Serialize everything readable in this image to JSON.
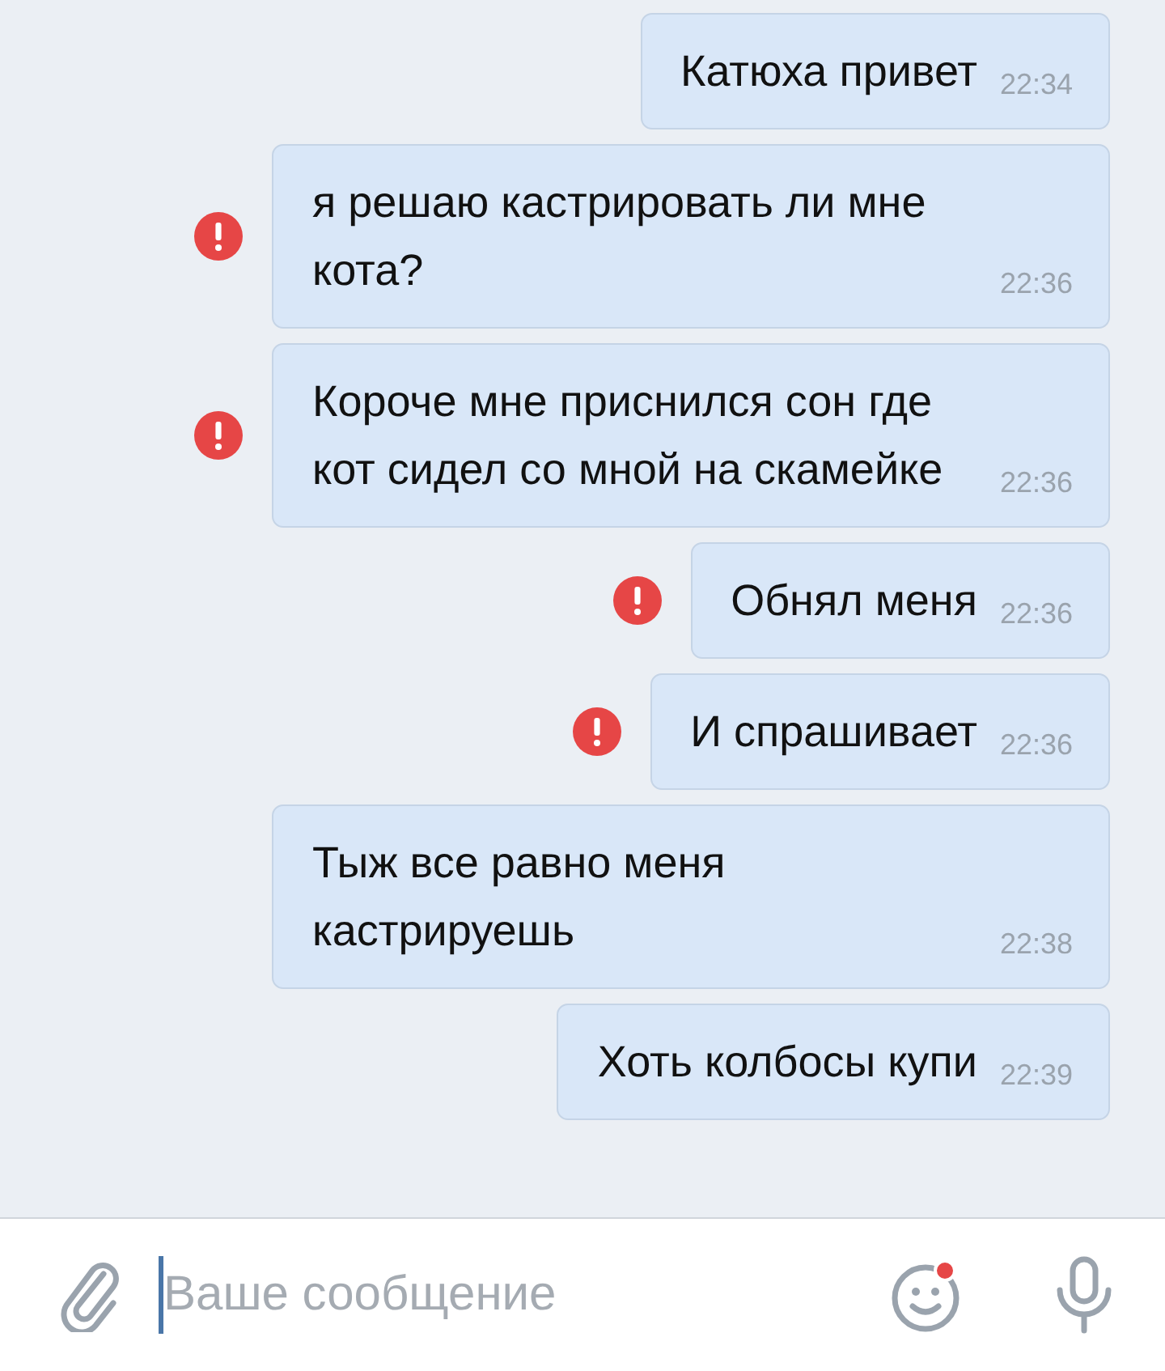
{
  "messages": [
    {
      "text": "Катюха привет",
      "time": "22:34",
      "failed": false
    },
    {
      "text": "я решаю кастрировать ли мне кота?",
      "time": "22:36",
      "failed": true
    },
    {
      "text": "Короче мне приснился сон где кот сидел со мной на скамейке",
      "time": "22:36",
      "failed": true
    },
    {
      "text": "Обнял меня",
      "time": "22:36",
      "failed": true
    },
    {
      "text": "И спрашивает",
      "time": "22:36",
      "failed": true
    },
    {
      "text": "Тыж все равно меня кастрируешь",
      "time": "22:38",
      "failed": false
    },
    {
      "text": "Хоть колбосы купи",
      "time": "22:39",
      "failed": false
    }
  ],
  "composer": {
    "placeholder": "Ваше сообщение",
    "emoji_badge": true
  }
}
